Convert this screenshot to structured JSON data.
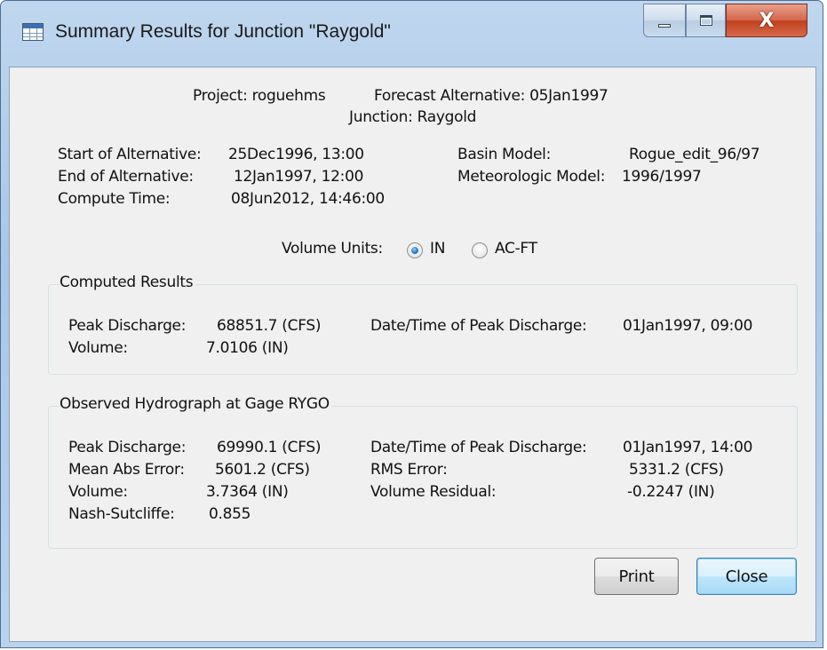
{
  "window": {
    "title": "Summary Results for Junction \"Raygold\"",
    "close_glyph": "X"
  },
  "header": {
    "project": "Project: roguehms",
    "forecast": "Forecast Alternative: 05Jan1997",
    "junction": "Junction: Raygold"
  },
  "info": {
    "start_label": "Start of Alternative:",
    "start_value": "25Dec1996, 13:00",
    "end_label": "End of Alternative:",
    "end_value": "12Jan1997, 12:00",
    "compute_label": "Compute Time:",
    "compute_value": "08Jun2012, 14:46:00",
    "basin_label": "Basin Model:",
    "basin_value": "Rogue_edit_96/97",
    "met_label": "Meteorologic Model:",
    "met_value": "1996/1997"
  },
  "volume_units": {
    "label": "Volume Units:",
    "options": [
      {
        "label": "IN",
        "checked": true
      },
      {
        "label": "AC-FT",
        "checked": false
      }
    ]
  },
  "computed": {
    "title": "Computed Results",
    "peak_label": "Peak Discharge:",
    "peak_value": "68851.7 (CFS)",
    "peak_time_label": "Date/Time of Peak Discharge:",
    "peak_time_value": "01Jan1997, 09:00",
    "volume_label": "Volume:",
    "volume_value": "7.0106 (IN)"
  },
  "observed": {
    "title": "Observed Hydrograph at Gage RYGO",
    "peak_label": "Peak Discharge:",
    "peak_value": "69990.1 (CFS)",
    "peak_time_label": "Date/Time of Peak Discharge:",
    "peak_time_value": "01Jan1997, 14:00",
    "mae_label": "Mean Abs Error:",
    "mae_value": "5601.2 (CFS)",
    "rms_label": "RMS Error:",
    "rms_value": "5331.2 (CFS)",
    "volume_label": "Volume:",
    "volume_value": "3.7364 (IN)",
    "residual_label": "Volume Residual:",
    "residual_value": "-0.2247 (IN)",
    "nash_label": "Nash-Sutcliffe:",
    "nash_value": "0.855"
  },
  "buttons": {
    "print": "Print",
    "close": "Close"
  },
  "colors": {
    "title_bar": "#b9d3ee",
    "client_bg": "#f0f0f0",
    "close_button": "#c0401f",
    "default_button": "#bee6fd"
  }
}
